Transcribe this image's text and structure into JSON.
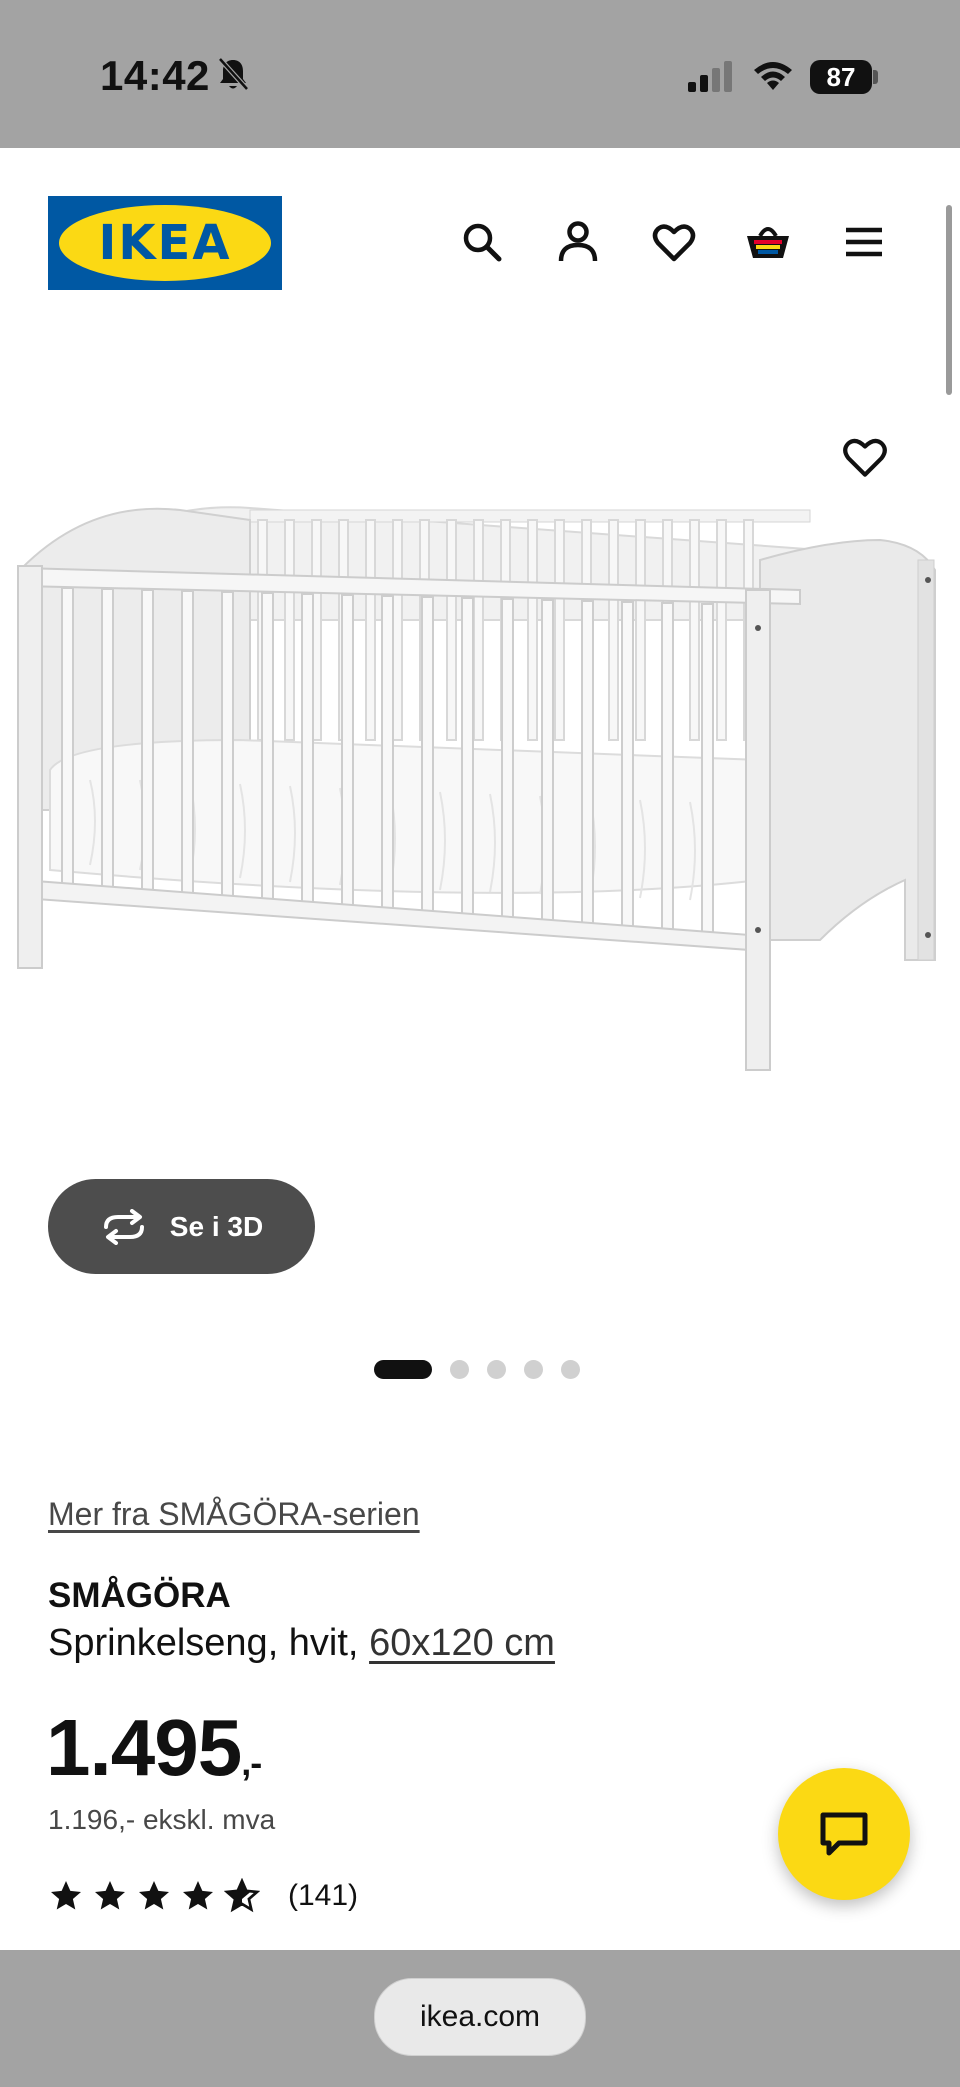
{
  "status_bar": {
    "time": "14:42",
    "battery": "87",
    "icons": [
      "bell-slash-icon",
      "signal-icon",
      "wifi-icon",
      "battery-icon"
    ]
  },
  "header": {
    "logo_text": "IKEA",
    "icons": [
      "search-icon",
      "account-icon",
      "heart-icon",
      "basket-icon",
      "menu-icon"
    ]
  },
  "gallery": {
    "view_3d_label": "Se i 3D",
    "slide_count": 5,
    "active_slide": 1
  },
  "product": {
    "series_link": "Mer fra SMÅGÖRA-serien",
    "name": "SMÅGÖRA",
    "description": "Sprinkelseng, hvit,",
    "size": "60x120 cm",
    "price": "1.495",
    "price_suffix": ",-",
    "price_ex_vat": "1.196,- ekskl. mva",
    "rating": 4.5,
    "review_count": "(141)"
  },
  "browser": {
    "url": "ikea.com"
  },
  "colors": {
    "ikea_blue": "#0058a3",
    "ikea_yellow": "#fbd914",
    "status_bar_gray": "#a3a3a3",
    "button_dark": "#4d4d4d"
  }
}
